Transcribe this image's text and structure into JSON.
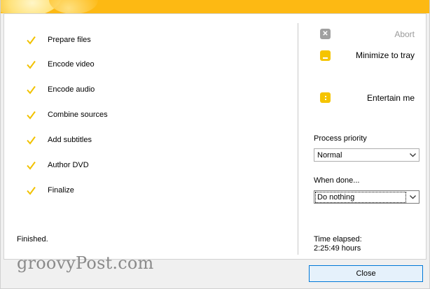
{
  "steps": [
    {
      "label": "Prepare files"
    },
    {
      "label": "Encode video"
    },
    {
      "label": "Encode audio"
    },
    {
      "label": "Combine sources"
    },
    {
      "label": "Add subtitles"
    },
    {
      "label": "Author DVD"
    },
    {
      "label": "Finalize"
    }
  ],
  "status_text": "Finished.",
  "actions": {
    "abort_label": "Abort",
    "minimize_label": "Minimize to tray",
    "entertain_label": "Entertain me"
  },
  "process_priority": {
    "label": "Process priority",
    "selected": "Normal"
  },
  "when_done": {
    "label": "When done...",
    "selected": "Do nothing"
  },
  "time_elapsed": {
    "label": "Time elapsed:",
    "value": "2:25:49 hours"
  },
  "close_label": "Close",
  "watermark": "groovyPost.com",
  "colors": {
    "accent": "#fdb913",
    "check": "#f2c200",
    "disabled_icon": "#a0a0a0",
    "close_border": "#0078d7"
  },
  "icons": {
    "step_done": "checkmark-icon",
    "abort": "x-box-icon",
    "minimize": "minimize-icon",
    "entertain": "dots-icon",
    "dropdown": "chevron-down-icon"
  }
}
